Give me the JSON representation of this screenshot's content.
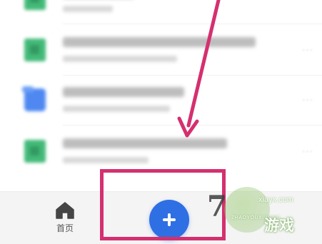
{
  "file_list": {
    "items": [
      {
        "icon": "spreadsheet-file-icon",
        "icon_color": "#2fb36a",
        "title_blurred": true,
        "meta_blurred": true
      },
      {
        "icon": "spreadsheet-file-icon",
        "icon_color": "#2fb36a",
        "title_blurred": true,
        "meta_blurred": true,
        "more": "···"
      },
      {
        "icon": "folder-icon",
        "icon_color": "#3c7cf0",
        "title_blurred": true,
        "meta_blurred": true,
        "more": "···"
      },
      {
        "icon": "spreadsheet-file-icon",
        "icon_color": "#2fb36a",
        "title_blurred": true,
        "meta_blurred": true,
        "more": "···"
      }
    ]
  },
  "bottom_bar": {
    "home": {
      "label": "首页",
      "icon": "home-icon"
    },
    "add_button": {
      "icon": "plus-icon",
      "color": "#2f6fe4"
    }
  },
  "annotation": {
    "color": "#d4306f",
    "shapes": [
      "arrow",
      "highlight-box"
    ]
  },
  "watermark": {
    "digit": "7",
    "url": "xiayx.com",
    "pinyin": "ZHAOYOUXIWANG",
    "brand": "游戏"
  }
}
